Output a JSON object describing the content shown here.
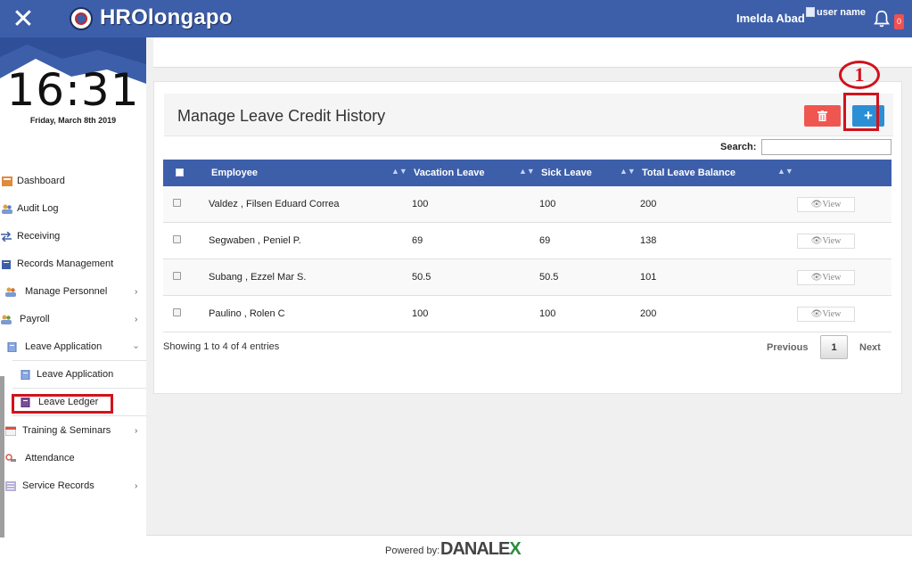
{
  "app": {
    "brand": "HROlongapo",
    "user_name": "Imelda Abad",
    "avatar_alt": "user name",
    "notification_count": "0"
  },
  "sidebar": {
    "time": "16:31",
    "date": "Friday, March 8th 2019",
    "items": [
      {
        "label": "Dashboard",
        "icon": "dashboard-icon"
      },
      {
        "label": "Audit Log",
        "icon": "people-icon"
      },
      {
        "label": "Receiving",
        "icon": "arrows-icon"
      },
      {
        "label": "Records Management",
        "icon": "folder-icon"
      },
      {
        "label": "Manage Personnel",
        "icon": "people-icon"
      },
      {
        "label": "Payroll",
        "icon": "people-icon"
      },
      {
        "label": "Leave Application",
        "icon": "document-icon"
      },
      {
        "label": "Leave Application",
        "icon": "document-icon"
      },
      {
        "label": "Leave Ledger",
        "icon": "ledger-icon"
      },
      {
        "label": "Training & Seminars",
        "icon": "calendar-icon"
      },
      {
        "label": "Attendance",
        "icon": "attendance-icon"
      },
      {
        "label": "Service Records",
        "icon": "list-icon"
      }
    ]
  },
  "page": {
    "title": "Manage Leave Credit History",
    "callout": "1",
    "search_label": "Search:",
    "search_value": "",
    "add_label": "+"
  },
  "table": {
    "columns": [
      "Employee",
      "Vacation Leave",
      "Sick Leave",
      "Total Leave Balance"
    ],
    "view_label": "View",
    "rows": [
      {
        "employee": "Valdez , Filsen Eduard Correa",
        "vacation": "100",
        "sick": "100",
        "total": "200"
      },
      {
        "employee": "Segwaben , Peniel P.",
        "vacation": "69",
        "sick": "69",
        "total": "138"
      },
      {
        "employee": "Subang , Ezzel Mar S.",
        "vacation": "50.5",
        "sick": "50.5",
        "total": "101"
      },
      {
        "employee": "Paulino , Rolen C",
        "vacation": "100",
        "sick": "100",
        "total": "200"
      }
    ]
  },
  "pagination": {
    "showing": "Showing 1 to 4 of 4 entries",
    "previous": "Previous",
    "page": "1",
    "next": "Next"
  },
  "footer": {
    "powered_by": "Powered by:",
    "brand_main": "DANALE",
    "brand_x": "X"
  },
  "colors": {
    "topbar": "#3d5faa",
    "delete": "#f05650",
    "add": "#2b8fd6",
    "annotation": "#d0131d"
  }
}
